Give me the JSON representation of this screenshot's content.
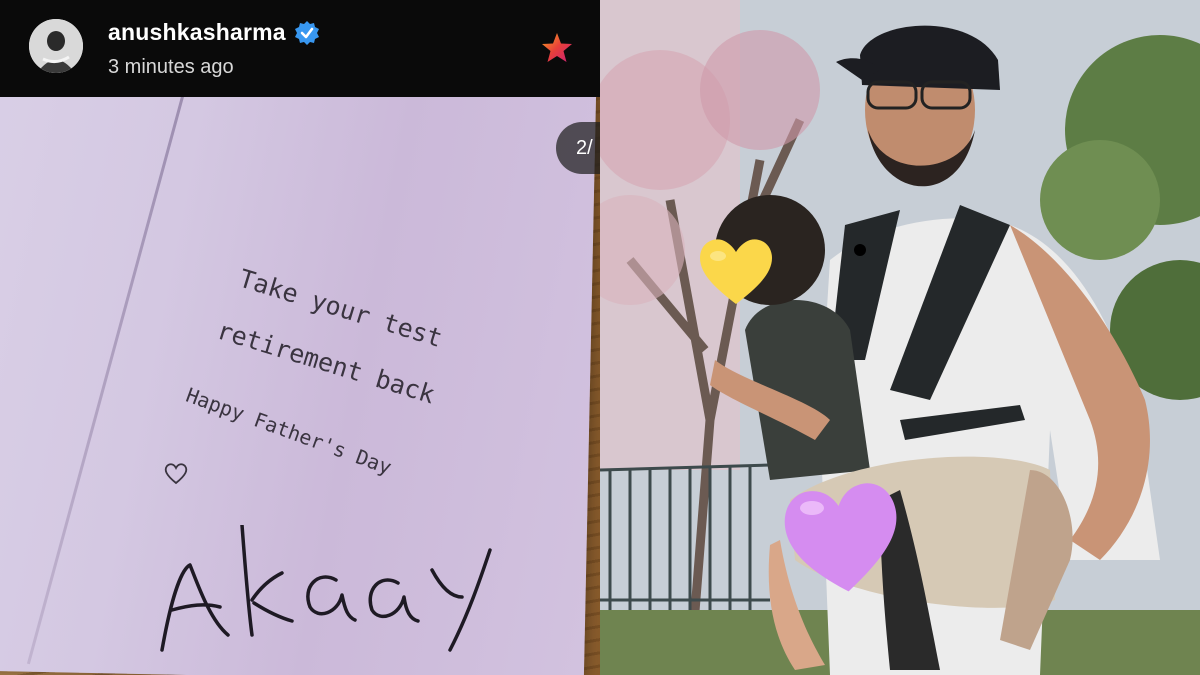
{
  "story": {
    "username": "anushkasharma",
    "timestamp": "3 minutes ago",
    "page_indicator": "2/",
    "card_text": {
      "line1": "Take your test",
      "line2": "retirement back",
      "line3": "Happy Father's Day",
      "signature": "Akaay"
    }
  },
  "colors": {
    "verified": "#3897f0",
    "star": "#e8403a",
    "card": "#d6c9e3",
    "emoji_yellow": "#fbd74a",
    "emoji_purple": "#d58cf0"
  },
  "icons": {
    "verified": "verified-badge-icon",
    "star": "star-icon",
    "heart": "heart-doodle-icon"
  }
}
